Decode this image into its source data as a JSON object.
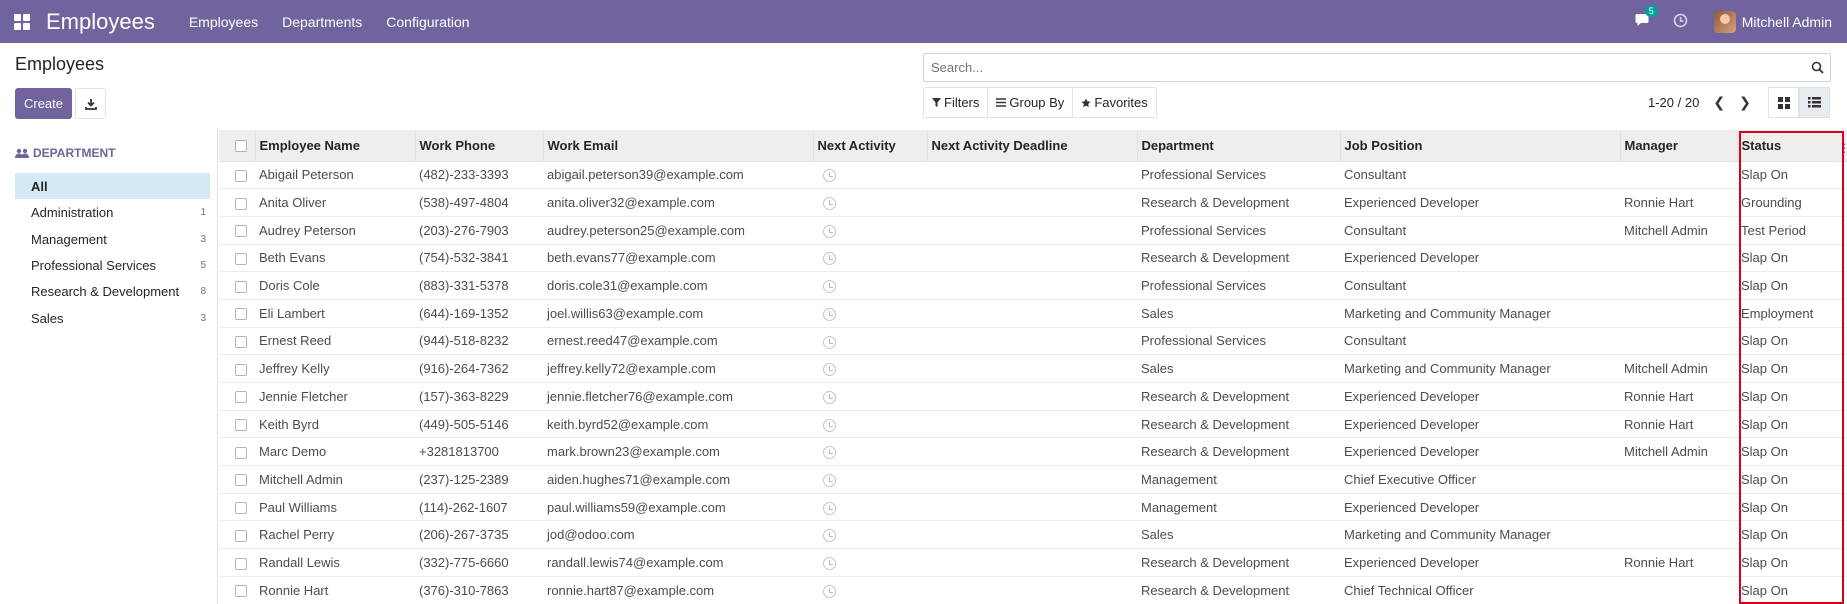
{
  "navbar": {
    "app_title": "Employees",
    "menus": [
      "Employees",
      "Departments",
      "Configuration"
    ],
    "message_count": "5",
    "user_name": "Mitchell Admin",
    "color": "#71639e"
  },
  "control_panel": {
    "breadcrumb": "Employees",
    "create_label": "Create",
    "search_placeholder": "Search...",
    "filters_label": "Filters",
    "group_by_label": "Group By",
    "favorites_label": "Favorites",
    "pager": "1-20 / 20"
  },
  "sidebar": {
    "title": "DEPARTMENT",
    "items": [
      {
        "label": "All",
        "count": ""
      },
      {
        "label": "Administration",
        "count": "1"
      },
      {
        "label": "Management",
        "count": "3"
      },
      {
        "label": "Professional Services",
        "count": "5"
      },
      {
        "label": "Research & Development",
        "count": "8"
      },
      {
        "label": "Sales",
        "count": "3"
      }
    ]
  },
  "table": {
    "headers": [
      "Employee Name",
      "Work Phone",
      "Work Email",
      "Next Activity",
      "Next Activity Deadline",
      "Department",
      "Job Position",
      "Manager",
      "Status"
    ],
    "rows": [
      [
        "Abigail Peterson",
        "(482)-233-3393",
        "abigail.peterson39@example.com",
        "Professional Services",
        "Consultant",
        "",
        "Slap On"
      ],
      [
        "Anita Oliver",
        "(538)-497-4804",
        "anita.oliver32@example.com",
        "Research & Development",
        "Experienced Developer",
        "Ronnie Hart",
        "Grounding"
      ],
      [
        "Audrey Peterson",
        "(203)-276-7903",
        "audrey.peterson25@example.com",
        "Professional Services",
        "Consultant",
        "Mitchell Admin",
        "Test Period"
      ],
      [
        "Beth Evans",
        "(754)-532-3841",
        "beth.evans77@example.com",
        "Research & Development",
        "Experienced Developer",
        "",
        "Slap On"
      ],
      [
        "Doris Cole",
        "(883)-331-5378",
        "doris.cole31@example.com",
        "Professional Services",
        "Consultant",
        "",
        "Slap On"
      ],
      [
        "Eli Lambert",
        "(644)-169-1352",
        "joel.willis63@example.com",
        "Sales",
        "Marketing and Community Manager",
        "",
        "Employment"
      ],
      [
        "Ernest Reed",
        "(944)-518-8232",
        "ernest.reed47@example.com",
        "Professional Services",
        "Consultant",
        "",
        "Slap On"
      ],
      [
        "Jeffrey Kelly",
        "(916)-264-7362",
        "jeffrey.kelly72@example.com",
        "Sales",
        "Marketing and Community Manager",
        "Mitchell Admin",
        "Slap On"
      ],
      [
        "Jennie Fletcher",
        "(157)-363-8229",
        "jennie.fletcher76@example.com",
        "Research & Development",
        "Experienced Developer",
        "Ronnie Hart",
        "Slap On"
      ],
      [
        "Keith Byrd",
        "(449)-505-5146",
        "keith.byrd52@example.com",
        "Research & Development",
        "Experienced Developer",
        "Ronnie Hart",
        "Slap On"
      ],
      [
        "Marc Demo",
        "+3281813700",
        "mark.brown23@example.com",
        "Research & Development",
        "Experienced Developer",
        "Mitchell Admin",
        "Slap On"
      ],
      [
        "Mitchell Admin",
        "(237)-125-2389",
        "aiden.hughes71@example.com",
        "Management",
        "Chief Executive Officer",
        "",
        "Slap On"
      ],
      [
        "Paul Williams",
        "(114)-262-1607",
        "paul.williams59@example.com",
        "Management",
        "Experienced Developer",
        "",
        "Slap On"
      ],
      [
        "Rachel Perry",
        "(206)-267-3735",
        "jod@odoo.com",
        "Sales",
        "Marketing and Community Manager",
        "",
        "Slap On"
      ],
      [
        "Randall Lewis",
        "(332)-775-6660",
        "randall.lewis74@example.com",
        "Research & Development",
        "Experienced Developer",
        "Ronnie Hart",
        "Slap On"
      ],
      [
        "Ronnie Hart",
        "(376)-310-7863",
        "ronnie.hart87@example.com",
        "Research & Development",
        "Chief Technical Officer",
        "",
        "Slap On"
      ]
    ]
  }
}
